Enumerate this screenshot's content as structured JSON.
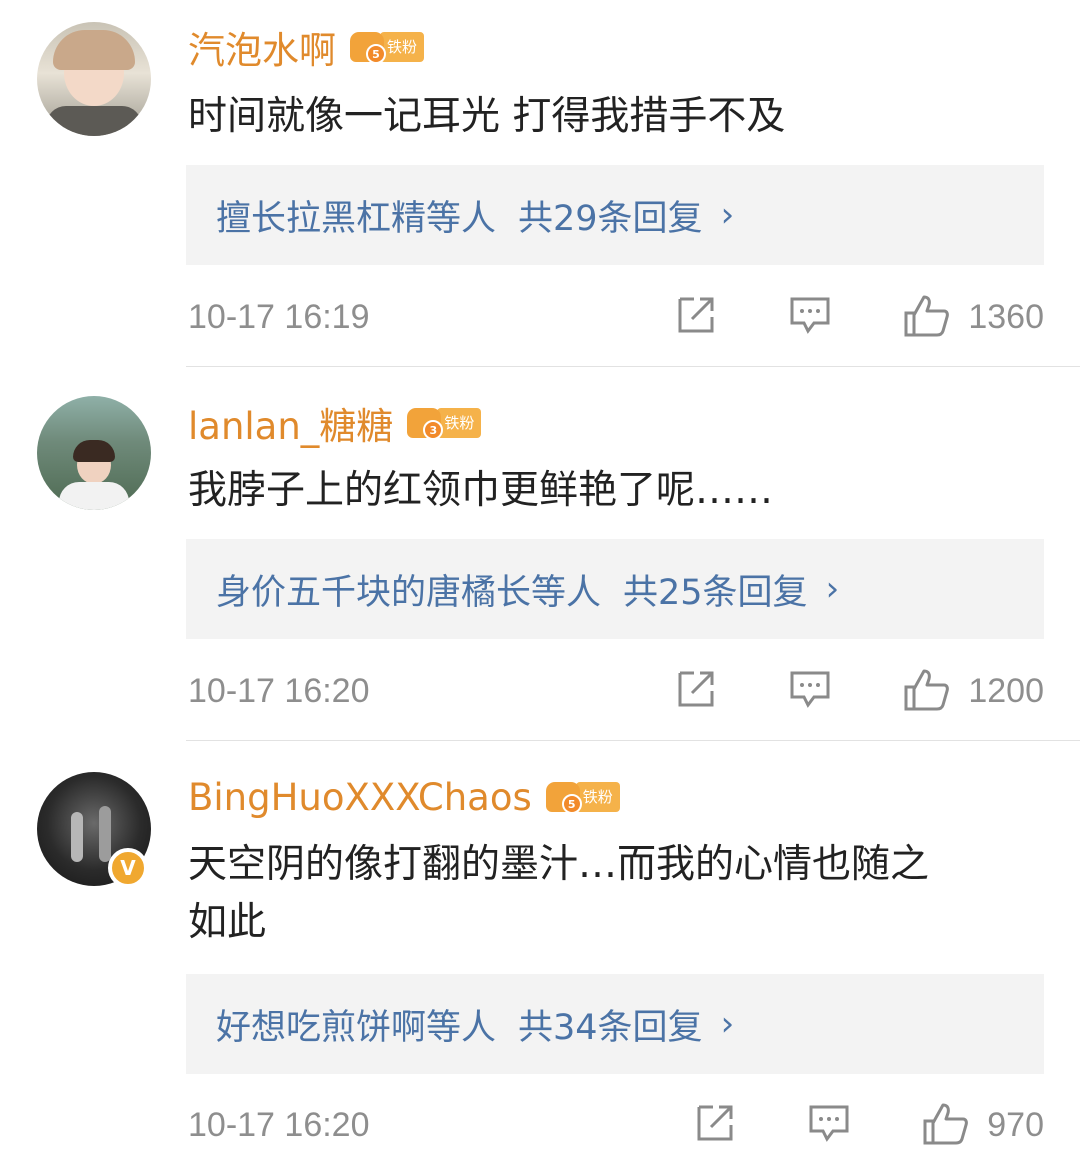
{
  "comments": [
    {
      "username": "汽泡水啊",
      "fan_level": "5",
      "fan_label": "铁粉",
      "text": "时间就像一记耳光 打得我措手不及",
      "replies_who": "擅长拉黑杠精等人",
      "replies_count": "共29条回复",
      "time": "10-17 16:19",
      "likes": "1360"
    },
    {
      "username": "lanlan_糖糖",
      "fan_level": "3",
      "fan_label": "铁粉",
      "text": "我脖子上的红领巾更鲜艳了呢……",
      "replies_who": "身价五千块的唐橘长等人",
      "replies_count": "共25条回复",
      "time": "10-17 16:20",
      "likes": "1200"
    },
    {
      "username": "BingHuoXXXChaos",
      "fan_level": "5",
      "fan_label": "铁粉",
      "text_line1": "天空阴的像打翻的墨汁…而我的心情也随之",
      "text_line2": "如此",
      "verified": "V",
      "replies_who": "好想吃煎饼啊等人",
      "replies_count": "共34条回复",
      "time": "10-17 16:20",
      "likes": "970"
    }
  ],
  "icons": [
    "share-icon",
    "comment-icon",
    "like-icon",
    "chevron-right-icon",
    "crown-icon"
  ],
  "colors": {
    "username": "#e08a2c",
    "reply_link": "#4b73a6",
    "reply_bg": "#f3f3f3",
    "meta": "#8e8e8e"
  }
}
